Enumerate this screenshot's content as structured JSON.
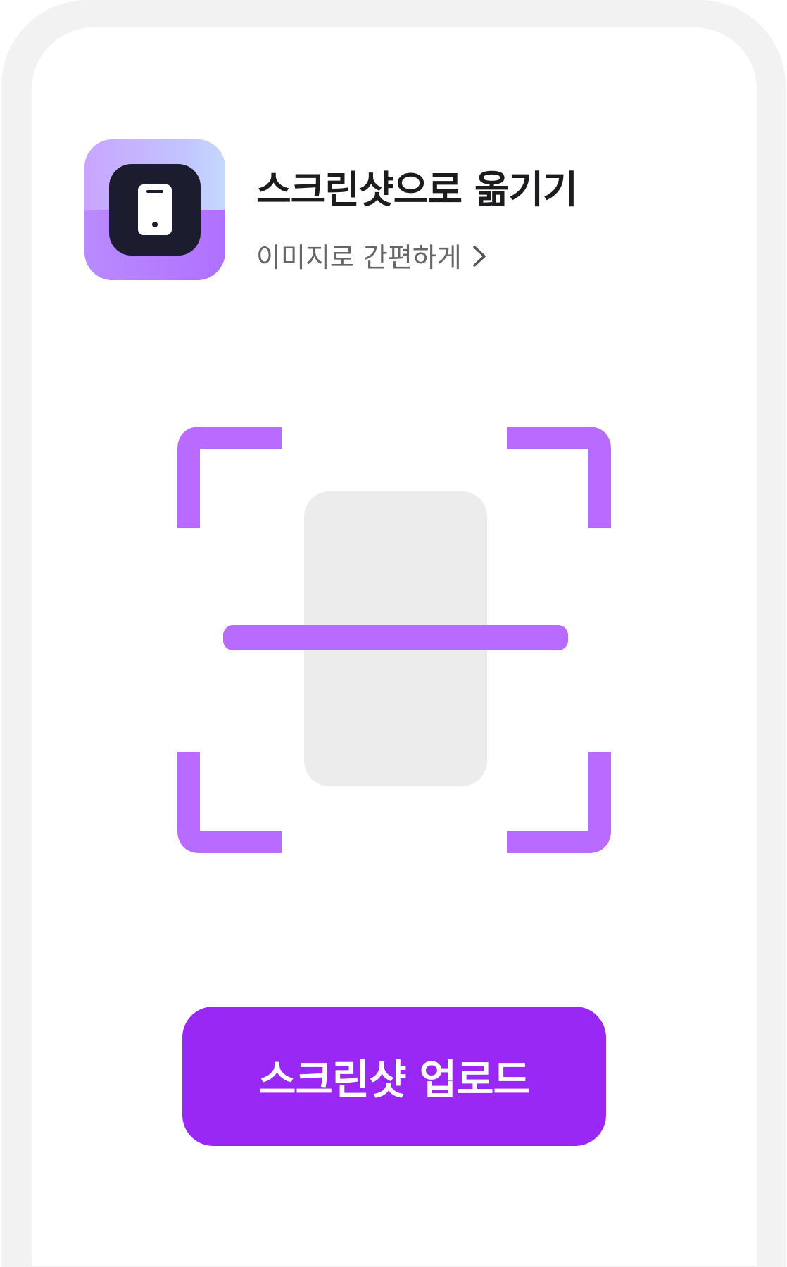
{
  "header": {
    "title": "스크린샷으로 옮기기",
    "subtitle": "이미지로 간편하게",
    "app_icon": "phone-icon",
    "link_icon": "chevron-right-icon"
  },
  "scanner": {
    "frame_icon": "scan-frame-icon",
    "accent_color": "#b96bff",
    "placeholder_color": "#ececec"
  },
  "actions": {
    "upload_label": "스크린샷 업로드",
    "button_color": "#9a28f5"
  }
}
